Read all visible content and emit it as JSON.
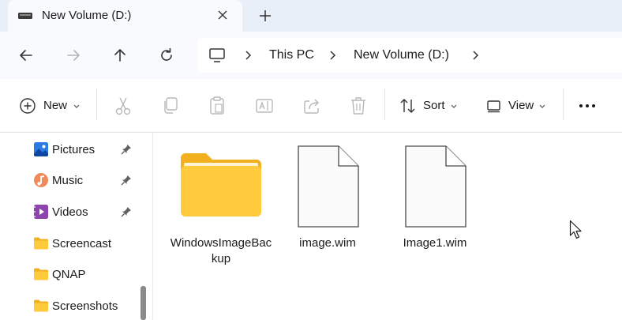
{
  "window": {
    "tab_title": "New Volume (D:)",
    "tab_icon": "drive-icon",
    "tab_close_icon": "close-icon",
    "new_tab_icon": "plus-icon"
  },
  "navigation": {
    "back_icon": "arrow-left-icon",
    "forward_icon": "arrow-right-icon",
    "up_icon": "arrow-up-icon",
    "refresh_icon": "refresh-icon"
  },
  "address": {
    "root_icon": "computer-icon",
    "breadcrumbs": [
      "This PC",
      "New Volume (D:)"
    ]
  },
  "toolbar": {
    "new_label": "New",
    "sort_label": "Sort",
    "view_label": "View",
    "icons": [
      "cut-icon",
      "copy-icon",
      "paste-icon",
      "rename-icon",
      "share-icon",
      "delete-icon",
      "more-icon"
    ]
  },
  "sidebar": {
    "items": [
      {
        "label": "Pictures",
        "icon": "pictures-icon",
        "pinned": true
      },
      {
        "label": "Music",
        "icon": "music-icon",
        "pinned": true
      },
      {
        "label": "Videos",
        "icon": "videos-icon",
        "pinned": true
      },
      {
        "label": "Screencast",
        "icon": "folder-icon",
        "pinned": false
      },
      {
        "label": "QNAP",
        "icon": "folder-icon",
        "pinned": false
      },
      {
        "label": "Screenshots",
        "icon": "folder-icon",
        "pinned": false
      }
    ]
  },
  "files": [
    {
      "name": "WindowsImageBackup",
      "type": "folder"
    },
    {
      "name": "image.wim",
      "type": "file"
    },
    {
      "name": "Image1.wim",
      "type": "file"
    }
  ],
  "colors": {
    "folder_front": "#FFCB3D",
    "folder_back": "#F2B01E",
    "titlebar_bg": "#E9EFF8",
    "navbar_bg": "#F8FAFD"
  }
}
